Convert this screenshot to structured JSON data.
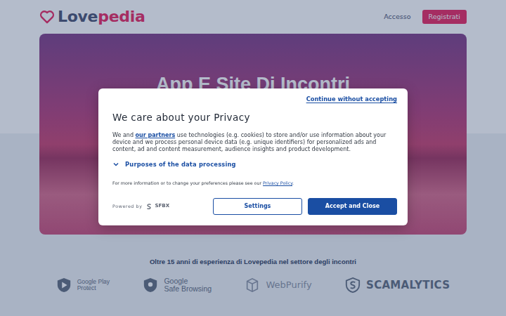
{
  "header": {
    "logo": {
      "part1": "Love",
      "part2": "pedia"
    },
    "login": "Accesso",
    "register": "Registrati"
  },
  "hero": {
    "title": "App E Site Di Incontri"
  },
  "trust": {
    "heading": "Oltre 15 anni di esperienza di Lovepedia nel settore degli incontri",
    "badges": [
      {
        "lines": [
          "Google Play",
          "Protect"
        ]
      },
      {
        "lines": [
          "Google",
          "Safe Browsing"
        ]
      },
      {
        "lines": [
          "WebPurify"
        ]
      },
      {
        "lines": [
          "SCAMALYTICS"
        ]
      }
    ]
  },
  "consent": {
    "skip": "Continue without accepting",
    "title": "We care about your Privacy",
    "text_before": "We and ",
    "partners_link": "our partners",
    "text_after": " use technologies (e.g. cookies) to store and/or use information about your device and we process personal device data (e.g. unique identifiers) for personalized ads and content, ad and content measurement, audience insights and product development.",
    "purposes": {
      "label": "Purposes of the data processing",
      "expanded": false
    },
    "more_before": "For more information or to change your preferences please see our ",
    "privacy_link": "Privacy Policy",
    "more_after": ".",
    "powered_by": "Powered by",
    "brand": "SFBX",
    "buttons": [
      {
        "label": "Settings",
        "kind": "outline"
      },
      {
        "label": "Accept and Close",
        "kind": "primary"
      }
    ]
  }
}
